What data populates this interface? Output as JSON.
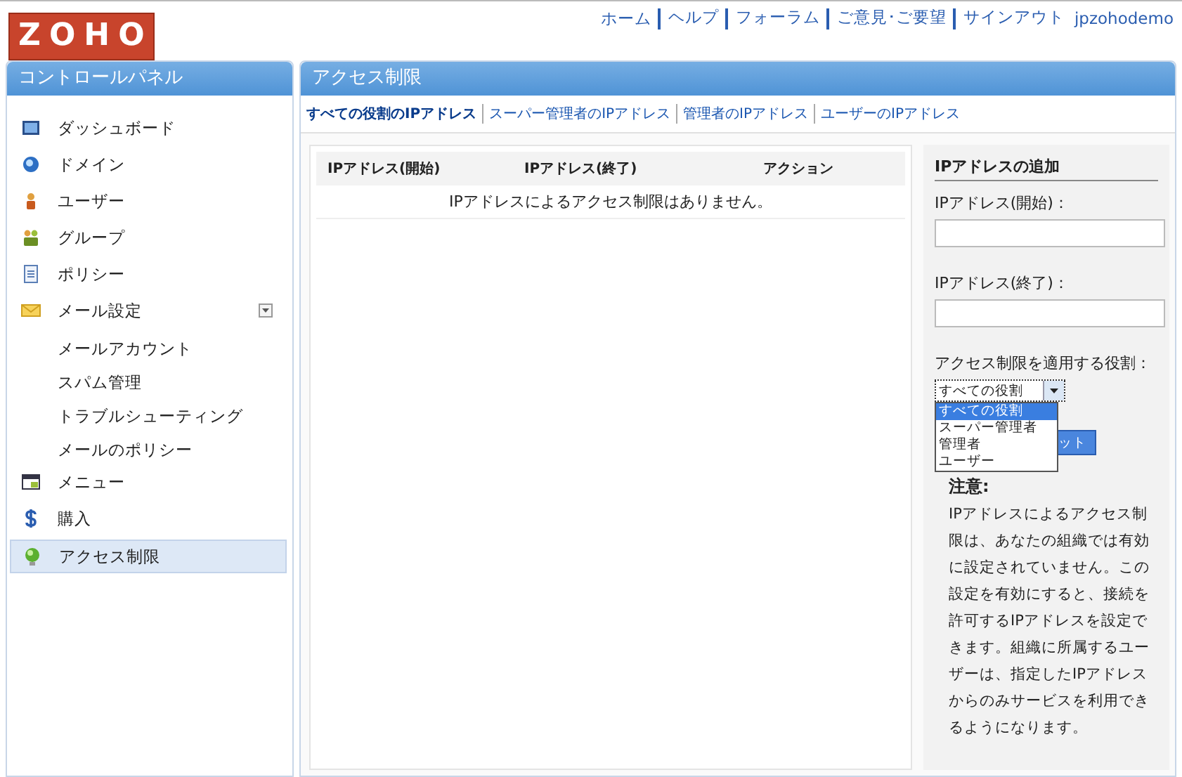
{
  "logo": "ZOHO",
  "top_links": [
    {
      "label": "ホーム"
    },
    {
      "label": "ヘルプ"
    },
    {
      "label": "フォーラム"
    },
    {
      "label": "ご意見･ご要望"
    },
    {
      "label": "サインアウト"
    }
  ],
  "user": "jpzohodemo",
  "sidebar": {
    "title": "コントロールパネル",
    "items": [
      {
        "label": "ダッシュボード",
        "selected": false
      },
      {
        "label": "ドメイン",
        "selected": false
      },
      {
        "label": "ユーザー",
        "selected": false
      },
      {
        "label": "グループ",
        "selected": false
      },
      {
        "label": "ポリシー",
        "selected": false
      },
      {
        "label": "メール設定",
        "selected": false,
        "expanded": true,
        "children": [
          {
            "label": "メールアカウント"
          },
          {
            "label": "スパム管理"
          },
          {
            "label": "トラブルシューティング"
          },
          {
            "label": "メールのポリシー"
          }
        ]
      },
      {
        "label": "メニュー",
        "selected": false
      },
      {
        "label": "購入",
        "selected": false
      },
      {
        "label": "アクセス制限",
        "selected": true
      }
    ]
  },
  "main": {
    "title": "アクセス制限",
    "tabs": [
      {
        "label": "すべての役割のIPアドレス",
        "selected": true
      },
      {
        "label": "スーパー管理者のIPアドレス",
        "selected": false
      },
      {
        "label": "管理者のIPアドレス",
        "selected": false
      },
      {
        "label": "ユーザーのIPアドレス",
        "selected": false
      }
    ],
    "table": {
      "columns": [
        "IPアドレス(開始)",
        "IPアドレス(終了)",
        "アクション"
      ],
      "empty_message": "IPアドレスによるアクセス制限はありません。"
    },
    "form": {
      "title": "IPアドレスの追加",
      "start_label": "IPアドレス(開始)：",
      "end_label": "IPアドレス(終了)：",
      "role_label": "アクセス制限を適用する役割：",
      "role_select": {
        "value": "すべての役割",
        "expanded": true,
        "options": [
          {
            "label": "すべての役割",
            "selected": true
          },
          {
            "label": "スーパー管理者",
            "selected": false
          },
          {
            "label": "管理者",
            "selected": false
          },
          {
            "label": "ユーザー",
            "selected": false
          }
        ]
      },
      "button": "ット",
      "note_title": "注意:",
      "note": "IPアドレスによるアクセス制限は、あなたの組織では有効に設定されていません。この設定を有効にすると、接続を許可するIPアドレスを設定できます。組織に所属するユーザーは、指定したIPアドレスからのみサービスを利用できるようになります。"
    }
  }
}
